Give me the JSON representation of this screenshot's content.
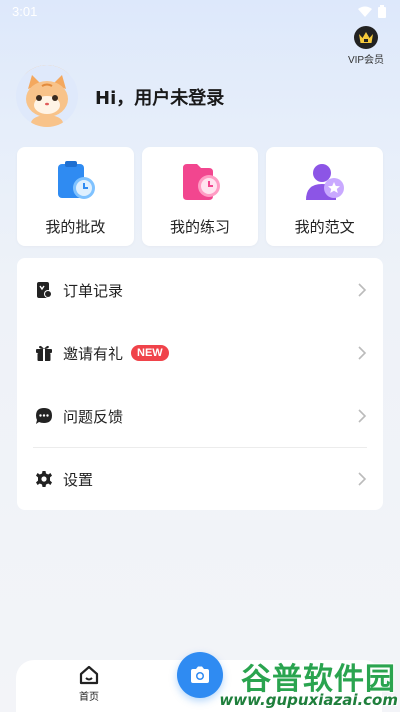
{
  "status_bar": {
    "time": "3:01"
  },
  "header": {
    "vip_label": "VIP会员",
    "greeting": "Hi，用户未登录"
  },
  "quick_actions": [
    {
      "label": "我的批改",
      "icon": "clipboard-clock-icon",
      "color": "#2f8bf2"
    },
    {
      "label": "我的练习",
      "icon": "folder-clock-icon",
      "color": "#f2468f"
    },
    {
      "label": "我的范文",
      "icon": "user-star-icon",
      "color": "#8c55e6"
    }
  ],
  "menu": {
    "items": [
      {
        "label": "订单记录",
        "icon": "order-record-icon"
      },
      {
        "label": "邀请有礼",
        "icon": "gift-icon",
        "badge": "NEW"
      },
      {
        "label": "问题反馈",
        "icon": "feedback-chat-icon"
      },
      {
        "label": "设置",
        "icon": "settings-gear-icon"
      }
    ]
  },
  "bottom_nav": {
    "home_label": "首页"
  },
  "watermark": {
    "title": "谷普软件园",
    "url": "www.gupuxiazai.com"
  },
  "colors": {
    "accent": "#2f8bf2",
    "badge": "#f0434a"
  }
}
